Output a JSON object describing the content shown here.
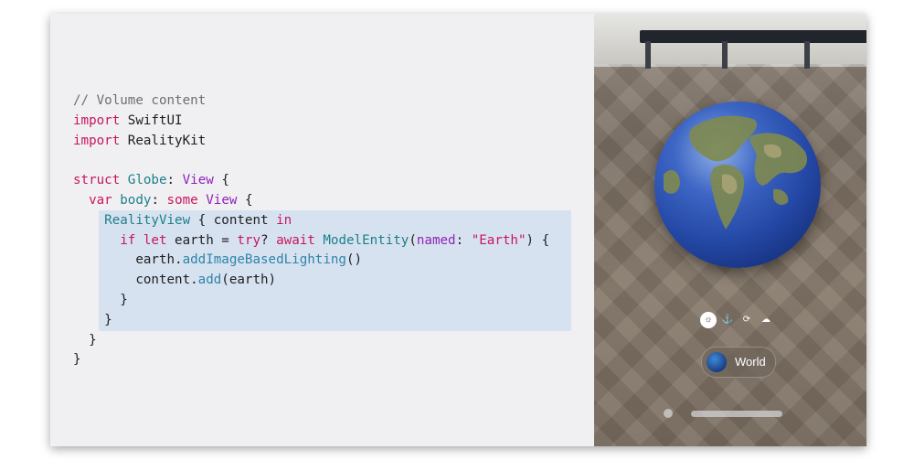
{
  "code_lines": [
    [
      {
        "t": "// Volume content",
        "c": "c-comment"
      }
    ],
    [
      {
        "t": "import",
        "c": "c-kw"
      },
      {
        "t": " SwiftUI",
        "c": ""
      }
    ],
    [
      {
        "t": "import",
        "c": "c-kw"
      },
      {
        "t": " RealityKit",
        "c": ""
      }
    ],
    [],
    [
      {
        "t": "struct",
        "c": "c-kw"
      },
      {
        "t": " ",
        "c": ""
      },
      {
        "t": "Globe",
        "c": "c-type"
      },
      {
        "t": ": ",
        "c": ""
      },
      {
        "t": "View",
        "c": "c-purple"
      },
      {
        "t": " {",
        "c": ""
      }
    ],
    [
      {
        "t": "  ",
        "c": ""
      },
      {
        "t": "var",
        "c": "c-kw"
      },
      {
        "t": " ",
        "c": ""
      },
      {
        "t": "body",
        "c": "c-type"
      },
      {
        "t": ": ",
        "c": ""
      },
      {
        "t": "some",
        "c": "c-kw"
      },
      {
        "t": " ",
        "c": ""
      },
      {
        "t": "View",
        "c": "c-purple"
      },
      {
        "t": " {",
        "c": ""
      }
    ],
    [
      {
        "t": "    ",
        "c": ""
      },
      {
        "t": "RealityView",
        "c": "c-type"
      },
      {
        "t": " { content ",
        "c": ""
      },
      {
        "t": "in",
        "c": "c-kw"
      }
    ],
    [
      {
        "t": "      ",
        "c": ""
      },
      {
        "t": "if",
        "c": "c-kw"
      },
      {
        "t": " ",
        "c": ""
      },
      {
        "t": "let",
        "c": "c-kw"
      },
      {
        "t": " earth = ",
        "c": ""
      },
      {
        "t": "try",
        "c": "c-kw"
      },
      {
        "t": "? ",
        "c": ""
      },
      {
        "t": "await",
        "c": "c-kw"
      },
      {
        "t": " ",
        "c": ""
      },
      {
        "t": "ModelEntity",
        "c": "c-type"
      },
      {
        "t": "(",
        "c": ""
      },
      {
        "t": "named",
        "c": "c-purple"
      },
      {
        "t": ": ",
        "c": ""
      },
      {
        "t": "\"Earth\"",
        "c": "c-str"
      },
      {
        "t": ") {",
        "c": ""
      }
    ],
    [
      {
        "t": "        earth.",
        "c": ""
      },
      {
        "t": "addImageBasedLighting",
        "c": "c-method"
      },
      {
        "t": "()",
        "c": ""
      }
    ],
    [
      {
        "t": "        content.",
        "c": ""
      },
      {
        "t": "add",
        "c": "c-method"
      },
      {
        "t": "(earth)",
        "c": ""
      }
    ],
    [
      {
        "t": "      }",
        "c": ""
      }
    ],
    [
      {
        "t": "    }",
        "c": ""
      }
    ],
    [
      {
        "t": "  }",
        "c": ""
      }
    ],
    [
      {
        "t": "}",
        "c": ""
      }
    ]
  ],
  "controls": [
    {
      "icon": "sun-icon",
      "glyph": "☼",
      "active": true
    },
    {
      "icon": "anchor-icon",
      "glyph": "⚓",
      "active": false
    },
    {
      "icon": "rotate-icon",
      "glyph": "⟳",
      "active": false
    },
    {
      "icon": "cloud-icon",
      "glyph": "☁",
      "active": false
    }
  ],
  "world_button": {
    "label": "World",
    "icon": "globe-icon"
  },
  "colors": {
    "keyword": "#c8175f",
    "type": "#1c7f88",
    "purple": "#9023b8",
    "method": "#2e84a8",
    "highlight": "#d7e2f0"
  }
}
